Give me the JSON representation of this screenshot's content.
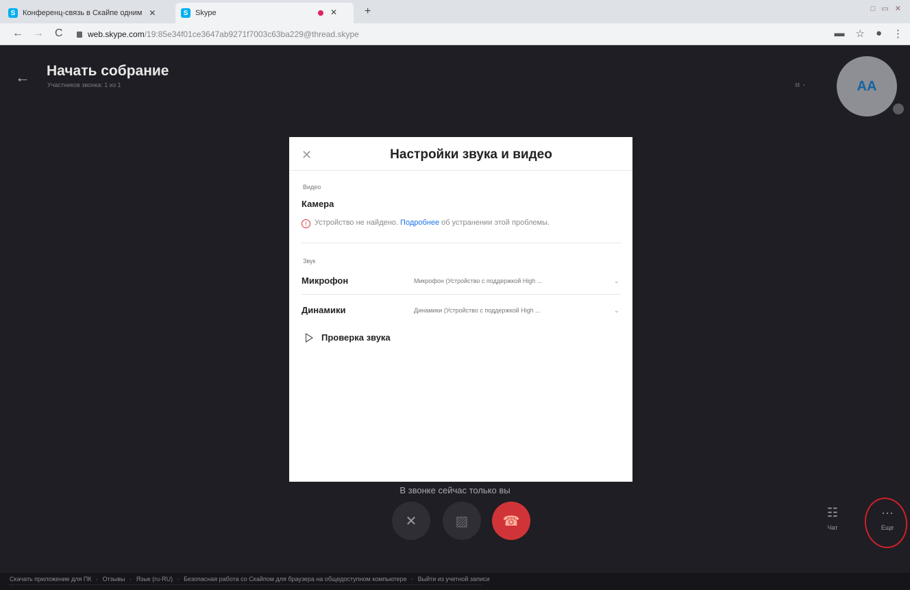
{
  "browser": {
    "tabs": [
      {
        "label": "Конференц-связь в Скайпе одним",
        "close": "✕"
      },
      {
        "label": "Skype",
        "close": "✕"
      }
    ],
    "new_tab": "+",
    "window_controls": "□ ▭ ✕",
    "nav_back": "←",
    "nav_forward": "→",
    "nav_reload": "C",
    "url_host": "web.skype.com",
    "url_path": "/19:85e34f01ce3647ab9271f7003c63ba229@thread.skype"
  },
  "header": {
    "back": "←",
    "title": "Начать собрание",
    "subtitle": "Участников звонка: 1 из 1",
    "avatar_initials": "AA",
    "grid_icon": "grid-icon"
  },
  "call": {
    "status": "В звонке сейчас только вы",
    "chat_label": "Чат",
    "more_label": "Еще",
    "more_glyph": "···"
  },
  "footer": {
    "links": [
      "Скачать приложение для ПК",
      "·",
      "Отзывы",
      "·",
      "Язык (ru-RU)",
      "·",
      "Безопасная работа со Скайпом для браузера на общедоступном компьютере",
      "·",
      "Выйти из учетной записи"
    ]
  },
  "dialog": {
    "close": "✕",
    "title": "Настройки звука и видео",
    "video_section": "Видео",
    "camera_label": "Камера",
    "warning_icon": "!",
    "warning_prefix": "Устройство не найдено.",
    "warning_link": "Подробнее",
    "warning_suffix": "об устранении этой проблемы.",
    "audio_section": "Звук",
    "mic_label": "Микрофон",
    "mic_value": "Микрофон (Устройство с поддержкой High ...",
    "speaker_label": "Динамики",
    "speaker_value": "Динамики (Устройство с поддержкой High ...",
    "chevron": "⌄",
    "test_label": "Проверка звука"
  },
  "colors": {
    "app_bg": "#1e1e24",
    "end_call": "#d13438",
    "link": "#1a73e8",
    "annotation": "#d0202a"
  }
}
